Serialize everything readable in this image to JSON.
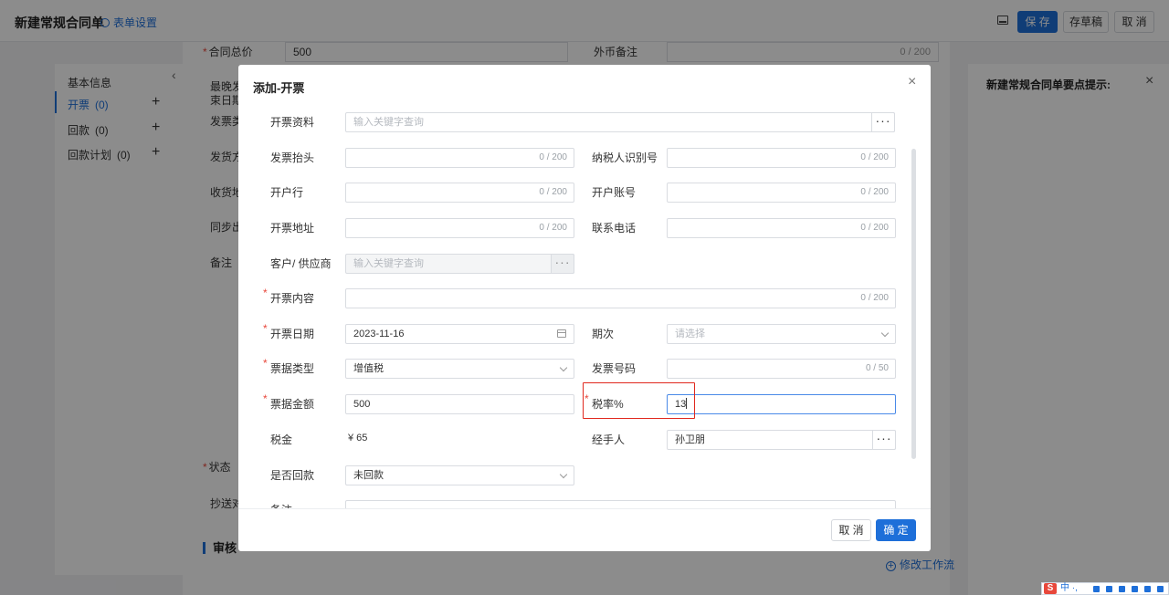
{
  "header": {
    "title": "新建常规合同单",
    "settings_link": "表单设置",
    "buttons": {
      "save": "保 存",
      "draft": "存草稿",
      "cancel": "取 消"
    }
  },
  "leftnav": {
    "items": [
      {
        "label": "基本信息",
        "count": ""
      },
      {
        "label": "开票",
        "count": "(0)"
      },
      {
        "label": "回款",
        "count": "(0)"
      },
      {
        "label": "回款计划",
        "count": "(0)"
      }
    ],
    "plus": "+"
  },
  "bgform": {
    "contract_total_label": "合同总价",
    "contract_total_value": "500",
    "fx_note_label": "外币备注",
    "fx_note_count": "0 / 200",
    "latest_label_1": "最晚发",
    "latest_label_2": "束日期",
    "invoice_type_label": "发票类",
    "ship_label": "发货方",
    "receive_label": "收货地",
    "sync_label": "同步出",
    "remark_label": "备注",
    "status_label": "状态",
    "cc_label": "抄送对",
    "audit_title": "审核"
  },
  "rightpanel": {
    "title": "新建常规合同单要点提示:",
    "workflow_link": "修改工作流"
  },
  "modal": {
    "title": "添加-开票",
    "fields": {
      "invoice_info": {
        "label": "开票资料",
        "placeholder": "输入关键字查询"
      },
      "invoice_header": {
        "label": "发票抬头",
        "count": "0 / 200"
      },
      "taxpayer_id": {
        "label": "纳税人识别号",
        "count": "0 / 200"
      },
      "bank": {
        "label": "开户行",
        "count": "0 / 200"
      },
      "account": {
        "label": "开户账号",
        "count": "0 / 200"
      },
      "address": {
        "label": "开票地址",
        "count": "0 / 200"
      },
      "phone": {
        "label": "联系电话",
        "count": "0 / 200"
      },
      "customer": {
        "label": "客户/ 供应商",
        "placeholder": "输入关键字查询"
      },
      "content": {
        "label": "开票内容",
        "count": "0 / 200"
      },
      "date": {
        "label": "开票日期",
        "value": "2023-11-16"
      },
      "period": {
        "label": "期次",
        "placeholder": "请选择"
      },
      "bill_type": {
        "label": "票据类型",
        "value": "增值税"
      },
      "invoice_no": {
        "label": "发票号码",
        "count": "0 / 50"
      },
      "amount": {
        "label": "票据金额",
        "value": "500"
      },
      "tax_rate": {
        "label": "税率%",
        "value": "13"
      },
      "tax": {
        "label": "税金",
        "value": "¥ 65"
      },
      "handler": {
        "label": "经手人",
        "value": "孙卫朋"
      },
      "repaid": {
        "label": "是否回款",
        "value": "未回款"
      },
      "remark": {
        "label": "备注"
      }
    },
    "required_mark": "*",
    "dots": "···",
    "footer": {
      "cancel": "取 消",
      "confirm": "确 定"
    }
  },
  "ime": {
    "text": "中 ·,"
  }
}
